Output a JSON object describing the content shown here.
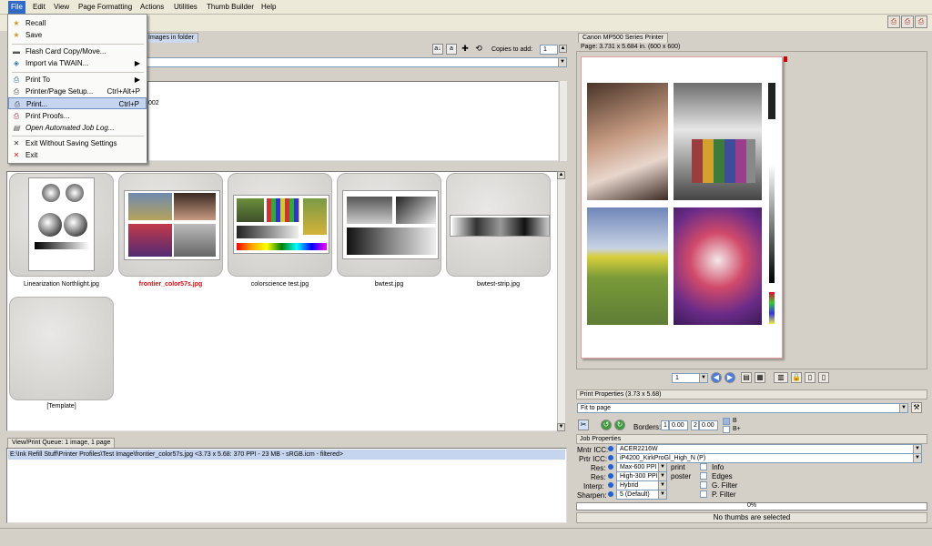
{
  "menubar": {
    "items": [
      "File",
      "Edit",
      "View",
      "Page Formatting",
      "Actions",
      "Utilities",
      "Thumb Builder",
      "Help"
    ]
  },
  "file_menu": {
    "items": [
      {
        "label": "Recall",
        "shortcut": "",
        "icon": "recall-icon"
      },
      {
        "label": "Save",
        "shortcut": "",
        "icon": "save-icon"
      },
      {
        "label": "Flash Card Copy/Move...",
        "shortcut": "",
        "icon": "flash-card-icon"
      },
      {
        "label": "Import via TWAIN...",
        "shortcut": "▶",
        "icon": "twain-icon"
      },
      {
        "label": "Print To",
        "shortcut": "▶",
        "icon": "print-to-icon"
      },
      {
        "label": "Printer/Page Setup...",
        "shortcut": "Ctrl+Alt+P",
        "icon": "page-setup-icon"
      },
      {
        "label": "Print...",
        "shortcut": "Ctrl+P",
        "icon": "print-icon"
      },
      {
        "label": "Print Proofs...",
        "shortcut": "",
        "icon": "print-proofs-icon"
      },
      {
        "label": "Open Automated Job Log...",
        "shortcut": "",
        "icon": "job-log-icon"
      },
      {
        "label": "Exit Without Saving Settings",
        "shortcut": "",
        "icon": "exit-nosave-icon"
      },
      {
        "label": "Exit",
        "shortcut": "",
        "icon": "exit-icon"
      }
    ]
  },
  "browser": {
    "tab_label": "Images in folder",
    "copies_label": "Copies to add:",
    "copies_value": "1",
    "path_fragment": "002"
  },
  "thumbnails": [
    {
      "name": "Linearization Northlight.jpg",
      "selected": false
    },
    {
      "name": "frontier_color57s.jpg",
      "selected": true
    },
    {
      "name": "colorscience test.jpg",
      "selected": false
    },
    {
      "name": "bwtest.jpg",
      "selected": false
    },
    {
      "name": "bwtest-strip.jpg",
      "selected": false
    },
    {
      "name": "[Template]",
      "selected": false
    }
  ],
  "queue": {
    "tab_label": "View/Print Queue: 1 image, 1 page",
    "row": "E:\\Ink Refill Stuff\\Printer Profiles\\Test Image\\frontier_color57s.jpg <3.73 x 5.68: 370 PPI - 23 MB - sRGB.icm - filtered>"
  },
  "printer": {
    "tab_label": "Canon MP500 Series Printer",
    "page_info": "Page: 3.731 x 5.684 in.  (600 x 600)",
    "page_number": "1",
    "print_props_label": "Print Properties (3.73 x 5.68)",
    "fit_mode": "Fit to page",
    "borders_label": "Borders:",
    "border_1": "1",
    "border_1_val": "0.00",
    "border_2": "2",
    "border_2_val": "0.00",
    "b_label": "B",
    "bplus_label": "B+"
  },
  "job": {
    "tab_label": "Job Properties",
    "mntr_icc_label": "Mntr ICC:",
    "mntr_icc": "ACER2216W",
    "prtr_icc_label": "Prtr ICC:",
    "prtr_icc": "iP4200_KirkProGl_High_N (P)",
    "res1_label": "Res:",
    "res1": "Max-600 PPI",
    "res1_suffix": "print",
    "res2_label": "Res:",
    "res2": "High-300 PPI",
    "res2_suffix": "poster",
    "interp_label": "Interp:",
    "interp": "Hybrid",
    "sharpen_label": "Sharpen:",
    "sharpen": "5 (Default)",
    "checks": [
      "Info",
      "Edges",
      "G. Filter",
      "P. Filter"
    ],
    "progress_text": "0%",
    "progress_value": 0,
    "status": "No thumbs are selected"
  }
}
